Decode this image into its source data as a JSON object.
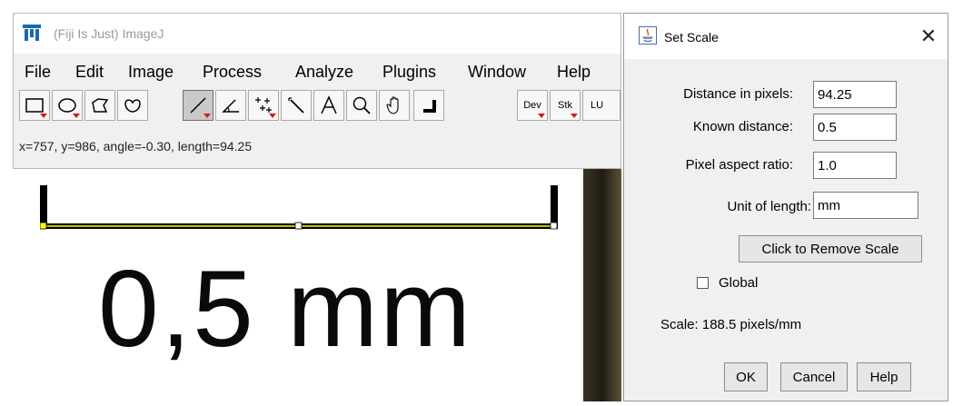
{
  "main_window": {
    "title": "(Fiji Is Just) ImageJ",
    "menus": [
      "File",
      "Edit",
      "Image",
      "Process",
      "Analyze",
      "Plugins",
      "Window",
      "Help"
    ],
    "toolbar": {
      "tools": [
        "rectangle-tool",
        "oval-tool",
        "polygon-tool",
        "freehand-tool",
        "line-tool",
        "angle-tool",
        "point-tool",
        "wand-tool",
        "text-tool",
        "magnifier-tool",
        "hand-tool",
        "color-picker-tool"
      ],
      "active_tool": "line-tool",
      "dev_label": "Dev",
      "stk_label": "Stk",
      "lut_label": "LU"
    },
    "status": "x=757, y=986, angle=-0.30, length=94.25"
  },
  "image": {
    "text": "0,5 mm"
  },
  "dialog": {
    "title": "Set Scale",
    "close_glyph": "✕",
    "fields": {
      "distance_label": "Distance in pixels:",
      "distance_value": "94.25",
      "known_label": "Known distance:",
      "known_value": "0.5",
      "aspect_label": "Pixel aspect ratio:",
      "aspect_value": "1.0",
      "unit_label": "Unit of length:",
      "unit_value": "mm"
    },
    "remove_scale_label": "Click to Remove Scale",
    "global_label": "Global",
    "global_checked": false,
    "scale_info": "Scale: 188.5 pixels/mm",
    "ok_label": "OK",
    "cancel_label": "Cancel",
    "help_label": "Help"
  },
  "colors": {
    "tool_arrow": "#d41a1a",
    "line_selection": "#ffff00",
    "logo_blue": "#1a66b3"
  }
}
